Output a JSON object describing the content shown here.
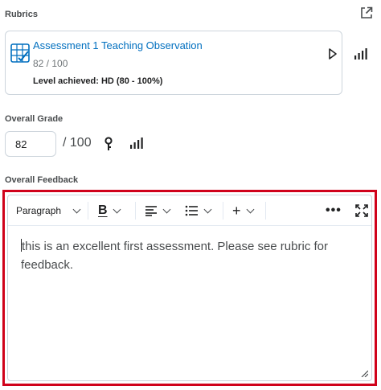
{
  "rubrics": {
    "title": "Rubrics",
    "popout_icon": "external-link-icon",
    "card": {
      "icon": "rubric-grid-icon",
      "name": "Assessment 1 Teaching Observation",
      "score": "82 / 100",
      "level": "Level achieved: HD (80 - 100%)"
    }
  },
  "grade": {
    "title": "Overall Grade",
    "value": "82",
    "max": "/ 100"
  },
  "feedback": {
    "title": "Overall Feedback",
    "toolbar": {
      "paragraph_label": "Paragraph",
      "bold_label": "B",
      "insert_label": "+",
      "more_label": "•••"
    },
    "content": "this is an excellent first assessment. Please see rubric for feedback."
  },
  "colors": {
    "link": "#006fbf",
    "highlight_border": "#d0021b",
    "border": "#cdd5dc"
  }
}
